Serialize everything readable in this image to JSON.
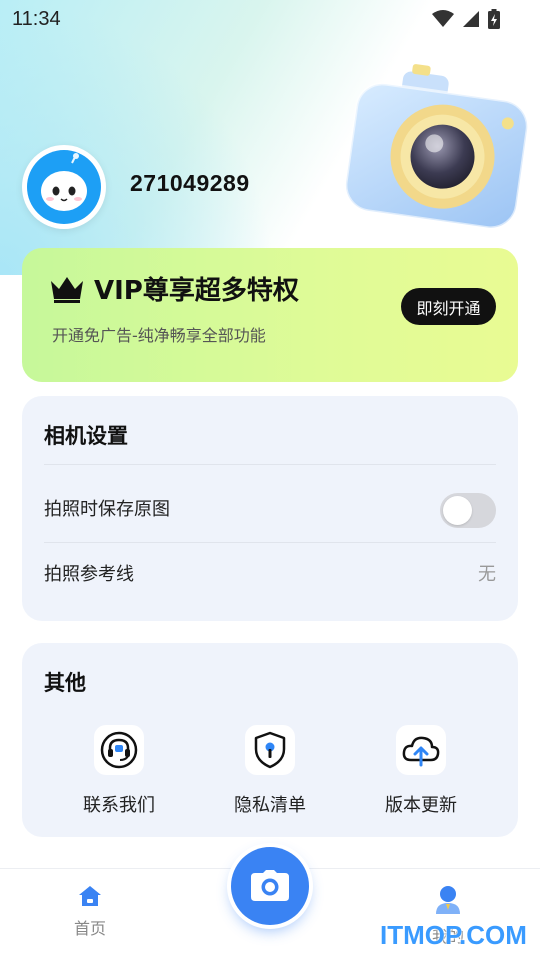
{
  "status_bar": {
    "time": "11:34",
    "icons": [
      "wifi-icon",
      "cell-signal-icon",
      "battery-charging-icon"
    ]
  },
  "profile": {
    "user_id": "271049289",
    "avatar_icon": "robot-avatar-icon"
  },
  "vip": {
    "title": "VIP尊享超多特权",
    "subtitle": "开通免广告-纯净畅享全部功能",
    "button": "即刻开通",
    "icon": "crown-icon"
  },
  "camera_settings": {
    "title": "相机设置",
    "rows": [
      {
        "label": "拍照时保存原图",
        "toggle_on": false
      },
      {
        "label": "拍照参考线",
        "value": "无"
      }
    ]
  },
  "other": {
    "title": "其他",
    "items": [
      {
        "label": "联系我们",
        "icon": "headset-icon"
      },
      {
        "label": "隐私清单",
        "icon": "shield-keyhole-icon"
      },
      {
        "label": "版本更新",
        "icon": "cloud-upload-icon"
      }
    ]
  },
  "tab_bar": {
    "tabs": [
      {
        "label": "首页",
        "icon": "home-icon",
        "active": true
      },
      {
        "label": "我的",
        "icon": "user-icon",
        "active": false
      }
    ],
    "center_icon": "camera-icon"
  },
  "watermark": "ITMOP.COM",
  "colors": {
    "accent": "#3a83f3",
    "vip_gradient_start": "#c6f89a",
    "vip_gradient_end": "#e9fb93",
    "card_bg": "#eff3fb"
  }
}
